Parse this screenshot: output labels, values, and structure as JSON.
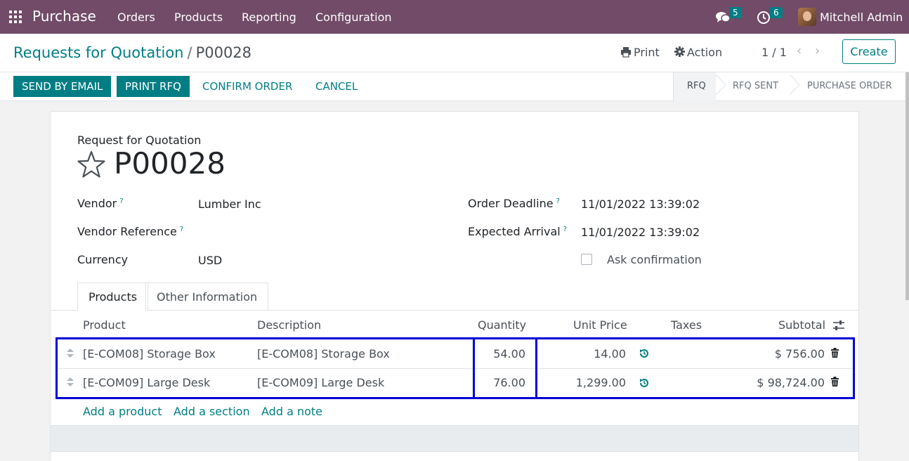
{
  "navbar": {
    "app_name": "Purchase",
    "menu": [
      "Orders",
      "Products",
      "Reporting",
      "Configuration"
    ],
    "messages_count": "5",
    "activities_count": "6",
    "user_name": "Mitchell Admin"
  },
  "control_panel": {
    "breadcrumb_parent": "Requests for Quotation",
    "breadcrumb_separator": "/",
    "breadcrumb_current": "P00028",
    "print_label": "Print",
    "action_label": "Action",
    "pager": "1 / 1",
    "create_label": "Create"
  },
  "statusbar": {
    "buttons": [
      "SEND BY EMAIL",
      "PRINT RFQ",
      "CONFIRM ORDER",
      "CANCEL"
    ],
    "stages": [
      "RFQ",
      "RFQ SENT",
      "PURCHASE ORDER"
    ],
    "active_stage": "RFQ"
  },
  "form": {
    "type_label": "Request for Quotation",
    "name": "P00028",
    "help_mark": "?",
    "fields_left": [
      {
        "label": "Vendor",
        "value": "Lumber Inc",
        "help": true
      },
      {
        "label": "Vendor Reference",
        "value": "",
        "help": true
      },
      {
        "label": "Currency",
        "value": "USD",
        "help": false
      }
    ],
    "fields_right": [
      {
        "label": "Order Deadline",
        "value": "11/01/2022 13:39:02",
        "help": true
      },
      {
        "label": "Expected Arrival",
        "value": "11/01/2022 13:39:02",
        "help": true
      }
    ],
    "ask_confirmation_label": "Ask confirmation",
    "ask_confirmation_checked": false
  },
  "tabs": [
    "Products",
    "Other Information"
  ],
  "order_lines": {
    "columns": [
      "Product",
      "Description",
      "Quantity",
      "Unit Price",
      "Taxes",
      "Subtotal"
    ],
    "rows": [
      {
        "product": "[E-COM08] Storage Box",
        "description": "[E-COM08] Storage Box",
        "quantity": "54.00",
        "unit_price": "14.00",
        "taxes": "",
        "subtotal": "$ 756.00"
      },
      {
        "product": "[E-COM09] Large Desk",
        "description": "[E-COM09] Large Desk",
        "quantity": "76.00",
        "unit_price": "1,299.00",
        "taxes": "",
        "subtotal": "$ 98,724.00"
      }
    ],
    "add_links": [
      "Add a product",
      "Add a section",
      "Add a note"
    ]
  },
  "colors": {
    "navbar": "#714B67",
    "accent": "#017e84",
    "highlight": "#0000d6"
  },
  "icons": [
    "apps-grid-icon",
    "chat-icon",
    "clock-icon",
    "print-icon",
    "gear-icon",
    "chevron-left-icon",
    "chevron-right-icon",
    "star-icon",
    "drag-handle-icon",
    "reset-icon",
    "trash-icon",
    "column-settings-icon"
  ]
}
